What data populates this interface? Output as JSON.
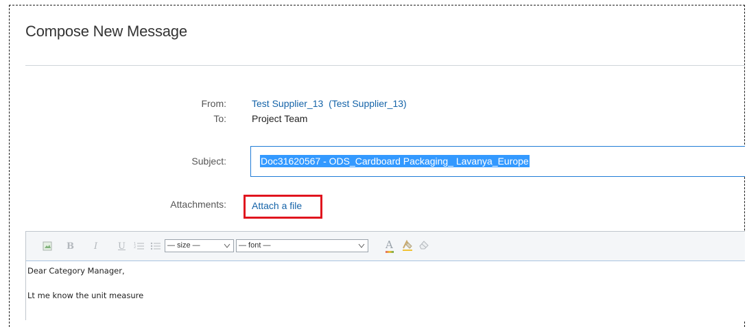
{
  "dialog": {
    "title": "Compose New Message"
  },
  "from": {
    "label": "From:",
    "name": "Test Supplier_13",
    "paren_name": "Test Supplier_13"
  },
  "to": {
    "label": "To:",
    "value": "Project Team"
  },
  "subject": {
    "label": "Subject:",
    "value": "Doc31620567 - ODS_Cardboard Packaging_ Lavanya_Europe"
  },
  "attachments": {
    "label": "Attachments:",
    "link": "Attach a file"
  },
  "toolbar": {
    "size_select": "— size —",
    "font_select": "— font —",
    "bold": "B",
    "italic": "I",
    "underline": "U",
    "font_color": "A"
  },
  "editor": {
    "lines": [
      "Dear Category Manager,",
      "Lt me know the unit measure"
    ]
  },
  "colors": {
    "link": "#1463a8",
    "highlight": "#e0141e",
    "selection": "#3399ff"
  }
}
